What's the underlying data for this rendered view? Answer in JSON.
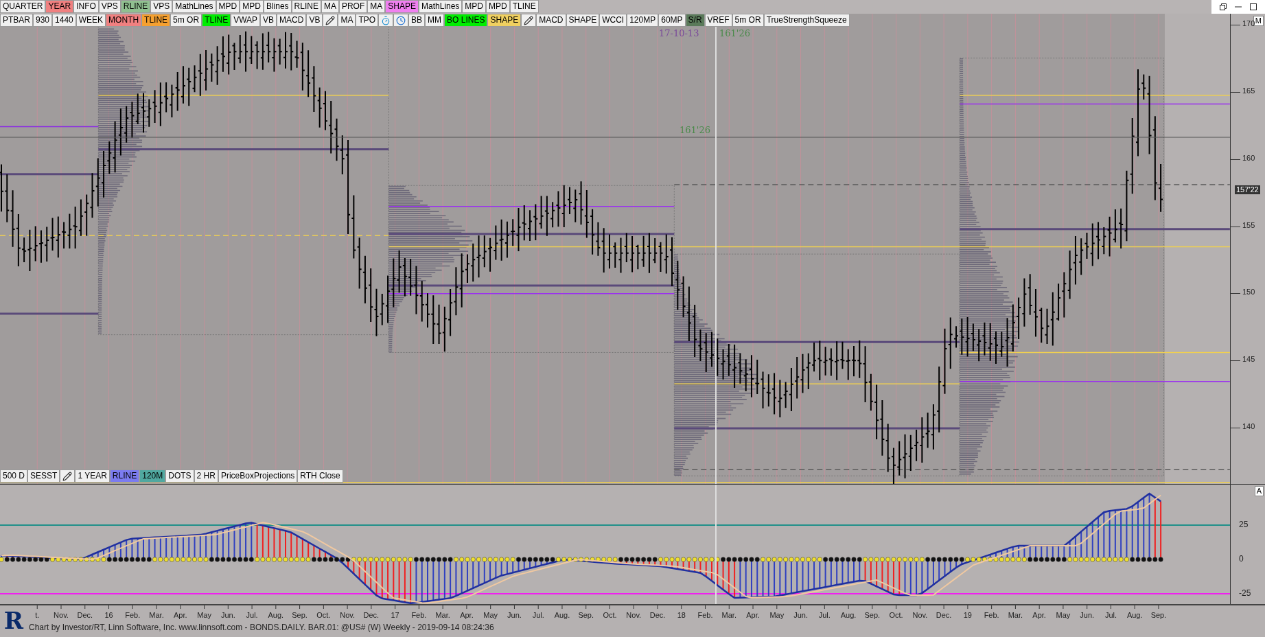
{
  "toolbar_top": [
    {
      "kind": "label",
      "label": "QUARTER",
      "color": "#f0f0f0"
    },
    {
      "kind": "label",
      "label": "YEAR",
      "color": "#f08080"
    },
    {
      "kind": "label",
      "label": "INFO",
      "color": "#f0f0f0"
    },
    {
      "kind": "label",
      "label": "VPS",
      "color": "#f0f0f0"
    },
    {
      "kind": "label",
      "label": "RLINE",
      "color": "#90c090"
    },
    {
      "kind": "label",
      "label": "VPS",
      "color": "#f0f0f0"
    },
    {
      "kind": "label",
      "label": "MathLines",
      "color": "#f0f0f0"
    },
    {
      "kind": "label",
      "label": "MPD",
      "color": "#f0f0f0"
    },
    {
      "kind": "label",
      "label": "MPD",
      "color": "#f0f0f0"
    },
    {
      "kind": "label",
      "label": "Blines",
      "color": "#f0f0f0"
    },
    {
      "kind": "label",
      "label": "RLINE",
      "color": "#f0f0f0"
    },
    {
      "kind": "label",
      "label": "MA",
      "color": "#f0f0f0"
    },
    {
      "kind": "label",
      "label": "PROF",
      "color": "#f0f0f0"
    },
    {
      "kind": "label",
      "label": "MA",
      "color": "#f0f0f0"
    },
    {
      "kind": "label",
      "label": "SHAPE",
      "color": "#f080f0"
    },
    {
      "kind": "label",
      "label": "MathLines",
      "color": "#f0f0f0"
    },
    {
      "kind": "label",
      "label": "MPD",
      "color": "#f0f0f0"
    },
    {
      "kind": "label",
      "label": "MPD",
      "color": "#f0f0f0"
    },
    {
      "kind": "label",
      "label": "TLINE",
      "color": "#f0f0f0"
    }
  ],
  "toolbar_chart": [
    {
      "kind": "label",
      "label": "PTBAR",
      "color": "#f0f0f0"
    },
    {
      "kind": "label",
      "label": "930",
      "color": "#f0f0f0"
    },
    {
      "kind": "label",
      "label": "1440",
      "color": "#f0f0f0"
    },
    {
      "kind": "label",
      "label": "WEEK",
      "color": "#f0f0f0"
    },
    {
      "kind": "label",
      "label": "MONTH",
      "color": "#f08080"
    },
    {
      "kind": "label",
      "label": "TLINE",
      "color": "#f5a030"
    },
    {
      "kind": "label",
      "label": "5m OR",
      "color": "#f0f0f0"
    },
    {
      "kind": "label",
      "label": "TLINE",
      "color": "#00ee00"
    },
    {
      "kind": "label",
      "label": "VWAP",
      "color": "#f0f0f0"
    },
    {
      "kind": "label",
      "label": "VB",
      "color": "#f0f0f0"
    },
    {
      "kind": "label",
      "label": "MACD",
      "color": "#f0f0f0"
    },
    {
      "kind": "label",
      "label": "VB",
      "color": "#f0f0f0"
    },
    {
      "kind": "edit",
      "color": "#f0f0f0"
    },
    {
      "kind": "label",
      "label": "MA",
      "color": "#f0f0f0"
    },
    {
      "kind": "label",
      "label": "TPO",
      "color": "#f0f0f0"
    },
    {
      "kind": "timer",
      "color": "#f0f0f0"
    },
    {
      "kind": "clock",
      "color": "#f0f0f0"
    },
    {
      "kind": "label",
      "label": "BB",
      "color": "#f0f0f0"
    },
    {
      "kind": "label",
      "label": "MM",
      "color": "#f0f0f0"
    },
    {
      "kind": "label",
      "label": "BO LINES",
      "color": "#00ee00"
    },
    {
      "kind": "label",
      "label": "SHAPE",
      "color": "#f0d060"
    },
    {
      "kind": "edit",
      "color": "#f0f0f0"
    },
    {
      "kind": "label",
      "label": "MACD",
      "color": "#f0f0f0"
    },
    {
      "kind": "label",
      "label": "SHAPE",
      "color": "#f0f0f0"
    },
    {
      "kind": "label",
      "label": "WCCI",
      "color": "#f0f0f0"
    },
    {
      "kind": "label",
      "label": "120MP",
      "color": "#f0f0f0"
    },
    {
      "kind": "label",
      "label": "60MP",
      "color": "#f0f0f0"
    },
    {
      "kind": "label",
      "label": "S/R",
      "color": "#5a7a5a"
    },
    {
      "kind": "label",
      "label": "VREF",
      "color": "#f0f0f0"
    },
    {
      "kind": "label",
      "label": "5m OR",
      "color": "#f0f0f0"
    },
    {
      "kind": "label",
      "label": "TrueStrengthSqueeze",
      "color": "#f0f0f0"
    }
  ],
  "toolbar_bottom": [
    {
      "kind": "label",
      "label": "500 D",
      "color": "#f0f0f0"
    },
    {
      "kind": "label",
      "label": "SESST",
      "color": "#f0f0f0"
    },
    {
      "kind": "edit",
      "color": "#f0f0f0"
    },
    {
      "kind": "label",
      "label": "1 YEAR",
      "color": "#f0f0f0"
    },
    {
      "kind": "label",
      "label": "RLINE",
      "color": "#7b7bf0"
    },
    {
      "kind": "label",
      "label": "120M",
      "color": "#50a8a0"
    },
    {
      "kind": "label",
      "label": "DOTS",
      "color": "#f0f0f0"
    },
    {
      "kind": "label",
      "label": "2 HR",
      "color": "#f0f0f0"
    },
    {
      "kind": "label",
      "label": "PriceBoxProjections",
      "color": "#f0f0f0"
    },
    {
      "kind": "label",
      "label": "RTH Close",
      "color": "#f0f0f0"
    }
  ],
  "chart": {
    "annotations": [
      "17-10-13",
      "161'26",
      "161'26"
    ]
  },
  "price_axis": {
    "panel_label": "M",
    "ticks": [
      "170",
      "165",
      "160",
      "155",
      "150",
      "145",
      "140"
    ],
    "current_price": "157'22"
  },
  "indicator_axis": {
    "panel_label": "A",
    "ticks": [
      "25",
      "0",
      "-25"
    ]
  },
  "time_axis": {
    "labels": [
      "t.",
      "Nov.",
      "Dec.",
      "16",
      "Feb.",
      "Mar.",
      "Apr.",
      "May",
      "Jun.",
      "Jul.",
      "Aug.",
      "Sep.",
      "Oct.",
      "Nov.",
      "Dec.",
      "17",
      "Feb.",
      "Mar.",
      "Apr.",
      "May",
      "Jun.",
      "Jul.",
      "Aug.",
      "Sep.",
      "Oct.",
      "Nov.",
      "Dec.",
      "18",
      "Feb.",
      "Mar.",
      "Apr.",
      "May",
      "Jun.",
      "Jul.",
      "Aug.",
      "Sep.",
      "Oct.",
      "Nov.",
      "Dec.",
      "19",
      "Feb.",
      "Mar.",
      "Apr.",
      "May",
      "Jun.",
      "Jul.",
      "Aug.",
      "Sep."
    ]
  },
  "footer": {
    "logo": "R",
    "credit": "Chart by Investor/RT, Linn Software, Inc. www.linnsoft.com - BONDS.DAILY. BAR.01: @US# (W) Weekly - 2019-09-14 08:24:36"
  }
}
